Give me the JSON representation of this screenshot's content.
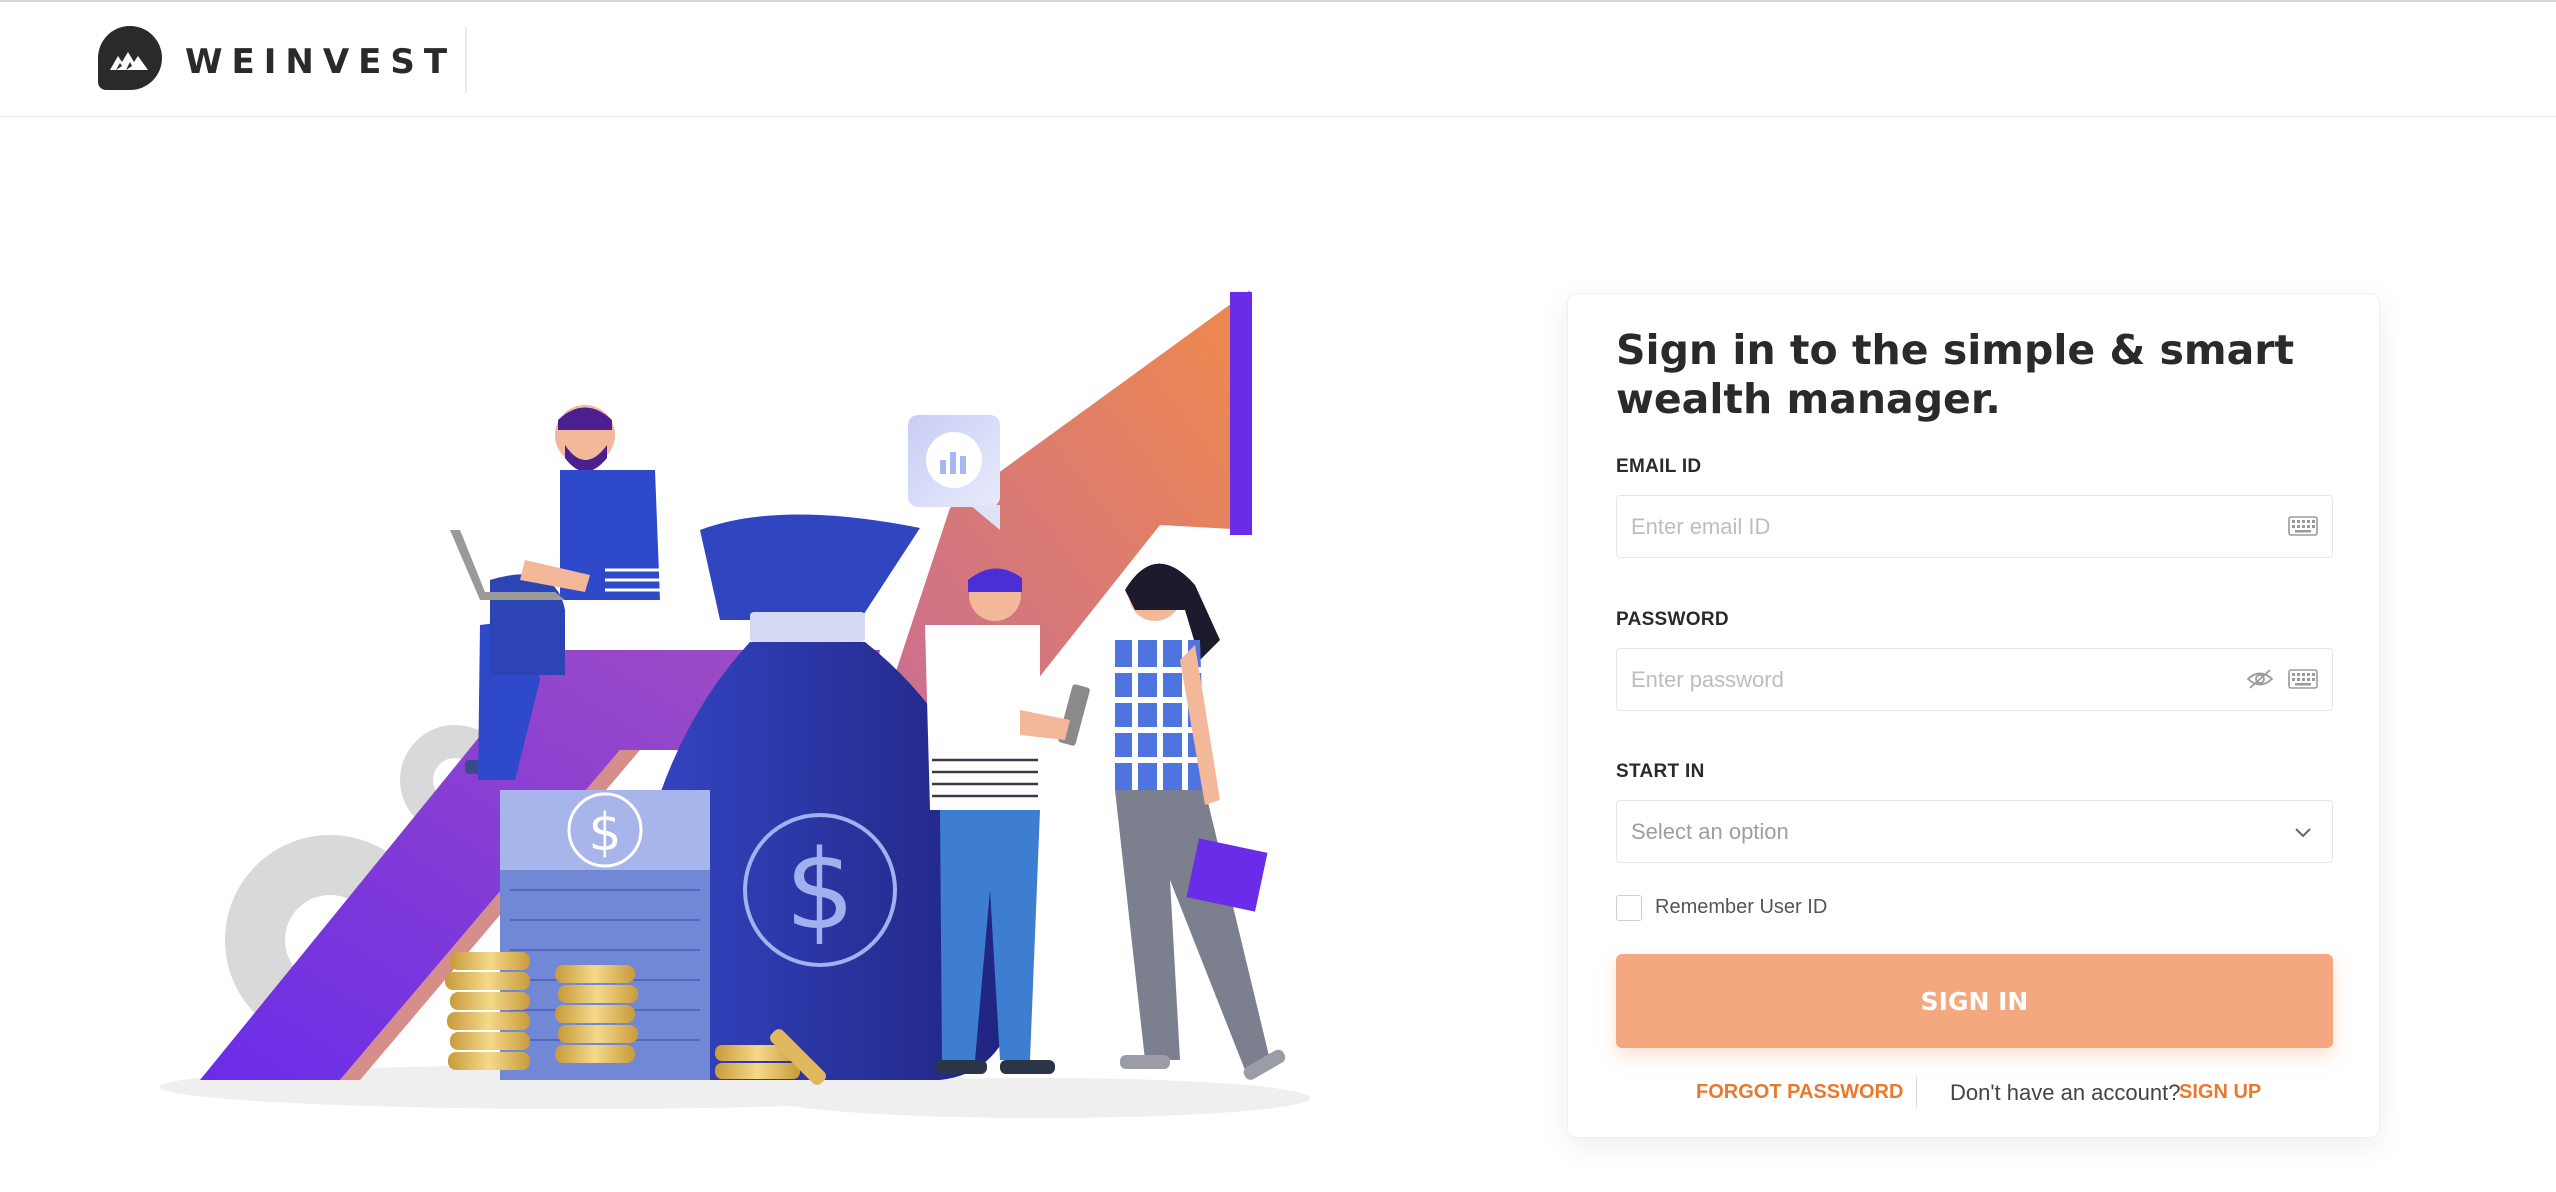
{
  "brand": {
    "name": "WEINVEST"
  },
  "login": {
    "title": "Sign in to the simple & smart wealth manager.",
    "email": {
      "label": "EMAIL ID",
      "placeholder": "Enter email ID",
      "value": ""
    },
    "password": {
      "label": "PASSWORD",
      "placeholder": "Enter password",
      "value": ""
    },
    "start_in": {
      "label": "START IN",
      "selected": "Select an option"
    },
    "remember": {
      "label": "Remember User ID",
      "checked": false
    },
    "submit_label": "SIGN IN",
    "forgot_label": "FORGOT PASSWORD",
    "no_account_text": "Don't have an account?",
    "signup_label": "SIGN UP"
  },
  "icons": {
    "logo": "mountain-logo-icon",
    "keyboard": "keyboard-icon",
    "visibility": "eye-off-icon",
    "dropdown": "chevron-down-icon",
    "chart_bubble": "bar-chart-icon",
    "dollar": "dollar-icon"
  },
  "colors": {
    "accent": "#e8792f",
    "button": "#f4a87f",
    "logo": "#2a2a2a",
    "illustration_purple": "#6a2ce8",
    "illustration_blue": "#2b3fb3"
  }
}
